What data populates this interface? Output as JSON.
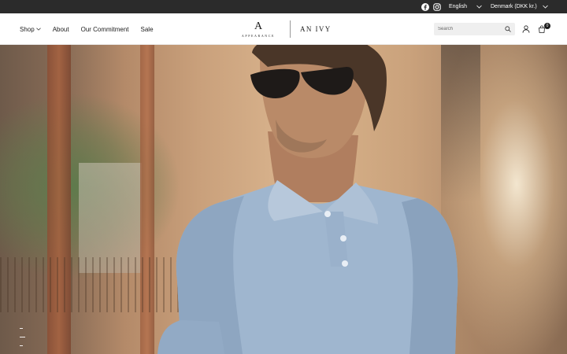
{
  "topbar": {
    "language": "English",
    "country": "Denmark (DKK kr.)",
    "icons": [
      "facebook-icon",
      "instagram-icon"
    ]
  },
  "nav": {
    "items": [
      {
        "label": "Shop",
        "has_dropdown": true
      },
      {
        "label": "About"
      },
      {
        "label": "Our Commitment"
      },
      {
        "label": "Sale"
      }
    ]
  },
  "logos": {
    "appearance_mark": "A",
    "appearance_word": "APPEARANCE",
    "anivy": "AN IVY"
  },
  "search": {
    "placeholder": "Search"
  },
  "cart": {
    "count": "0"
  },
  "colors": {
    "topbar_bg": "#2b2b2b",
    "text": "#1c1c1c",
    "search_bg": "#efefef"
  }
}
